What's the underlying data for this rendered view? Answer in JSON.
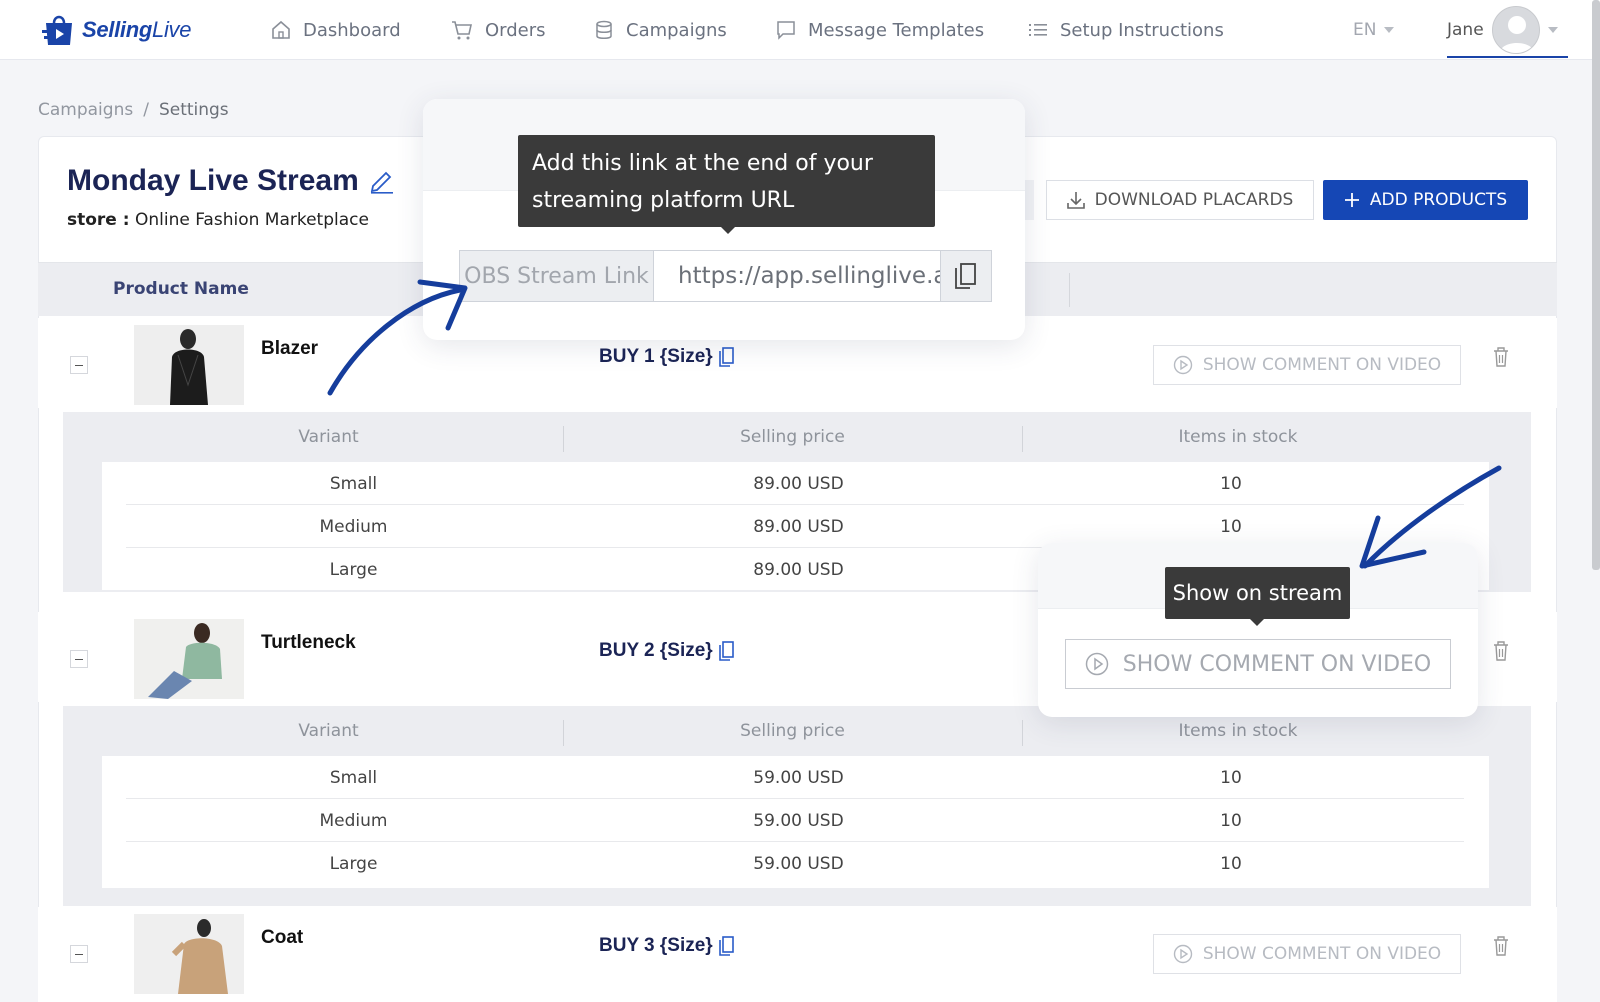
{
  "brand": {
    "name_a": "Selling",
    "name_b": "Live",
    "color": "#1a44a8"
  },
  "nav": {
    "items": [
      {
        "label": "Dashboard",
        "icon": "home-icon"
      },
      {
        "label": "Orders",
        "icon": "cart-icon"
      },
      {
        "label": "Campaigns",
        "icon": "database-icon"
      },
      {
        "label": "Message Templates",
        "icon": "message-icon"
      },
      {
        "label": "Setup Instructions",
        "icon": "list-icon"
      }
    ],
    "lang": "EN",
    "user": "Jane"
  },
  "breadcrumb": {
    "items": [
      "Campaigns",
      "/",
      "Settings"
    ]
  },
  "page": {
    "title": "Monday Live Stream",
    "store_label": "store :",
    "store_value": "Online Fashion Marketplace",
    "download_label": "DOWNLOAD PLACARDS",
    "add_label": "ADD PRODUCTS",
    "accent": "#1547b5"
  },
  "table": {
    "product_name_header": "Product Name",
    "variant_headers": [
      "Variant",
      "Selling price",
      "Items in stock"
    ],
    "show_comment_label": "SHOW COMMENT ON VIDEO"
  },
  "products": [
    {
      "name": "Blazer",
      "buy": "BUY 1 {Size}",
      "variants": [
        {
          "variant": "Small",
          "price": "89.00 USD",
          "stock": "10"
        },
        {
          "variant": "Medium",
          "price": "89.00 USD",
          "stock": "10"
        },
        {
          "variant": "Large",
          "price": "89.00 USD",
          "stock": ""
        }
      ]
    },
    {
      "name": "Turtleneck",
      "buy": "BUY 2 {Size}",
      "variants": [
        {
          "variant": "Small",
          "price": "59.00 USD",
          "stock": "10"
        },
        {
          "variant": "Medium",
          "price": "59.00 USD",
          "stock": "10"
        },
        {
          "variant": "Large",
          "price": "59.00 USD",
          "stock": "10"
        }
      ]
    },
    {
      "name": "Coat",
      "buy": "BUY 3 {Size}"
    }
  ],
  "obs": {
    "tooltip": "Add this link at the end of your streaming platform URL",
    "label": "OBS Stream Link",
    "value": "https://app.sellinglive.a"
  },
  "stream": {
    "tooltip": "Show on stream",
    "button_label": "SHOW COMMENT ON VIDEO"
  }
}
